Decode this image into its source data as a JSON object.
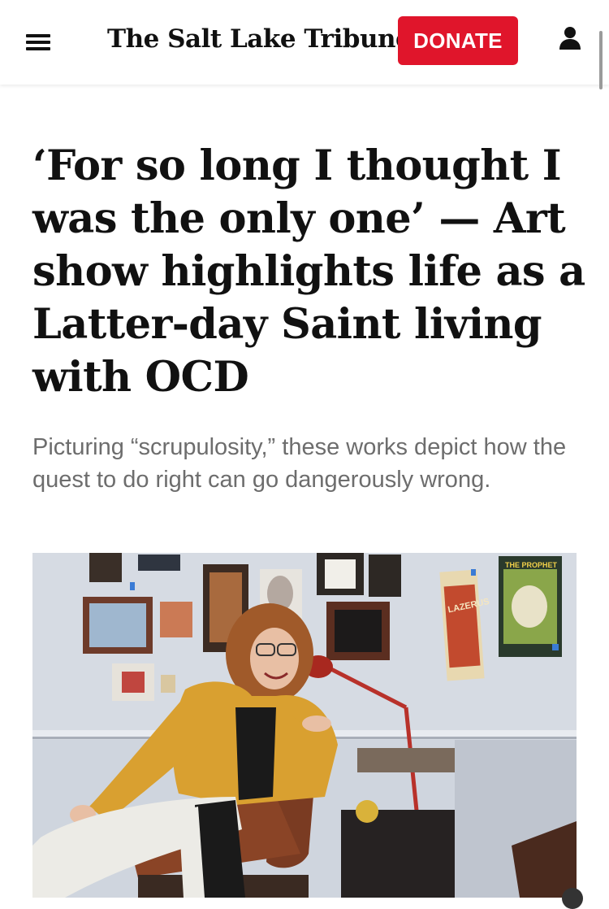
{
  "header": {
    "masthead": "The Salt Lake Tribune",
    "donate_label": "DONATE",
    "menu_icon": "hamburger-menu-icon",
    "account_icon": "user-account-icon",
    "brand_color": "#e0152b"
  },
  "article": {
    "headline": "‘For so long I thought I was the only one’ — Art show highlights life as a Latter-day Saint living with OCD",
    "dek": "Picturing “scrupulosity,” these works depict how the quest to do right can go dangerously wrong."
  },
  "poster_lazerus": {
    "title": "LAZERUS"
  },
  "poster_prophet": {
    "title": "THE PROPHET"
  }
}
